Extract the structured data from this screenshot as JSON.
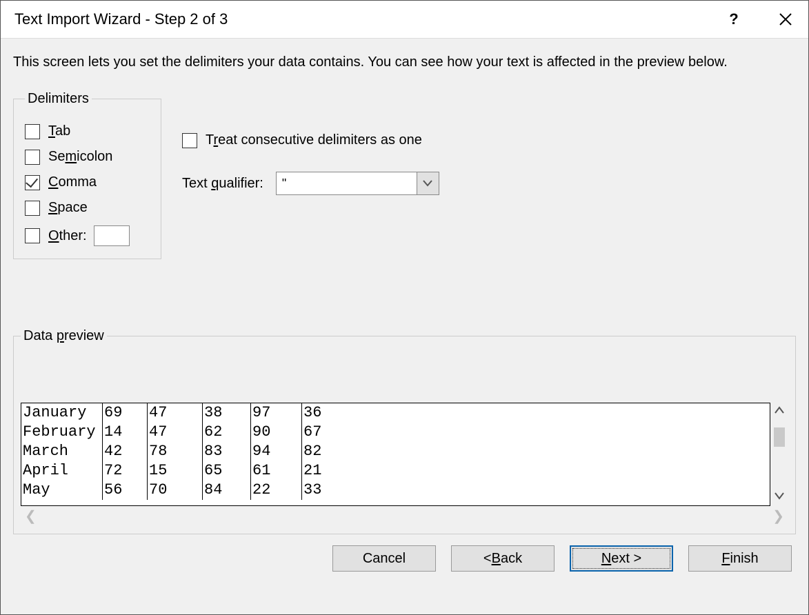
{
  "title": "Text Import Wizard - Step 2 of 3",
  "intro": "This screen lets you set the delimiters your data contains.  You can see how your text is affected in the preview below.",
  "delimiters": {
    "legend": "Delimiters",
    "tab": {
      "label": "Tab",
      "checked": false
    },
    "semicolon": {
      "label": "Semicolon",
      "checked": false
    },
    "comma": {
      "label": "Comma",
      "checked": true
    },
    "space": {
      "label": "Space",
      "checked": false
    },
    "other": {
      "label": "Other:",
      "checked": false,
      "value": ""
    }
  },
  "treat": {
    "label": "Treat consecutive delimiters as one",
    "checked": false
  },
  "qualifier": {
    "label": "Text qualifier:",
    "value": "\""
  },
  "preview": {
    "legend": "Data preview",
    "rows": [
      [
        "January",
        "69",
        "47",
        "38",
        "97",
        "36"
      ],
      [
        "February",
        "14",
        "47",
        "62",
        "90",
        "67"
      ],
      [
        "March",
        "42",
        "78",
        "83",
        "94",
        "82"
      ],
      [
        "April",
        "72",
        "15",
        "65",
        "61",
        "21"
      ],
      [
        "May",
        "56",
        "70",
        "84",
        "22",
        "33"
      ]
    ]
  },
  "buttons": {
    "cancel": "Cancel",
    "back": "< Back",
    "next": "Next >",
    "finish": "Finish"
  }
}
